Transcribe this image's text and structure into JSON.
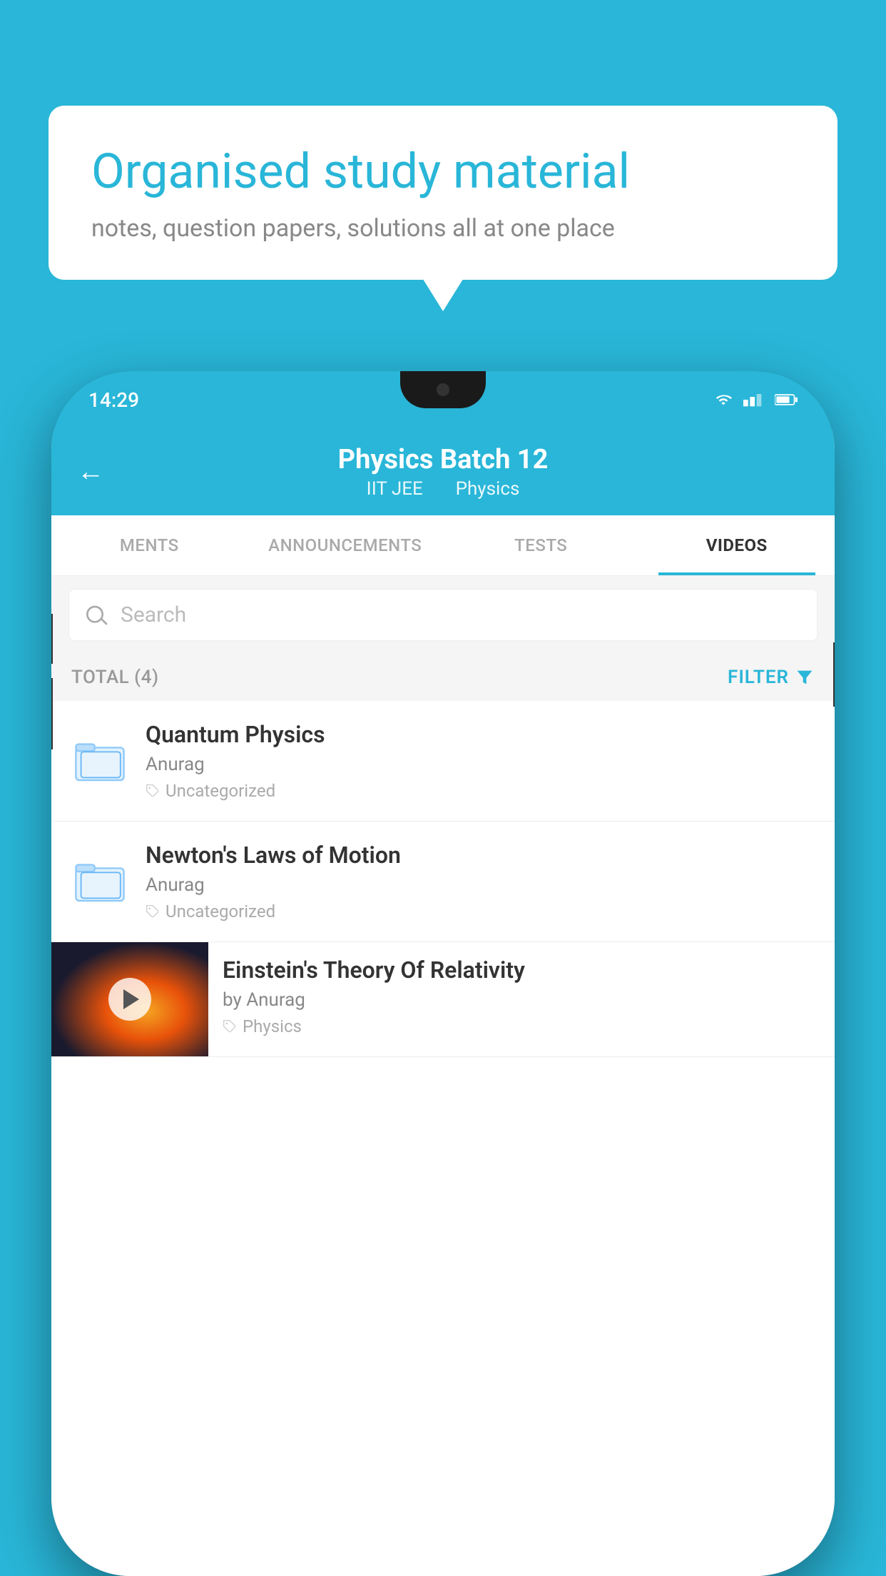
{
  "background_color": "#29b6d8",
  "speech_bubble": {
    "title": "Organised study material",
    "subtitle": "notes, question papers, solutions all at one place"
  },
  "phone": {
    "status_bar": {
      "time": "14:29"
    },
    "header": {
      "title": "Physics Batch 12",
      "subtitle_part1": "IIT JEE",
      "subtitle_part2": "Physics",
      "back_label": "←"
    },
    "tabs": [
      {
        "label": "MENTS",
        "active": false
      },
      {
        "label": "ANNOUNCEMENTS",
        "active": false
      },
      {
        "label": "TESTS",
        "active": false
      },
      {
        "label": "VIDEOS",
        "active": true
      }
    ],
    "search": {
      "placeholder": "Search"
    },
    "filter_bar": {
      "total_label": "TOTAL (4)",
      "filter_label": "FILTER"
    },
    "video_items": [
      {
        "title": "Quantum Physics",
        "author": "Anurag",
        "tag": "Uncategorized",
        "has_thumb": false
      },
      {
        "title": "Newton's Laws of Motion",
        "author": "Anurag",
        "tag": "Uncategorized",
        "has_thumb": false
      },
      {
        "title": "Einstein's Theory Of Relativity",
        "author": "by Anurag",
        "tag": "Physics",
        "has_thumb": true
      }
    ]
  }
}
